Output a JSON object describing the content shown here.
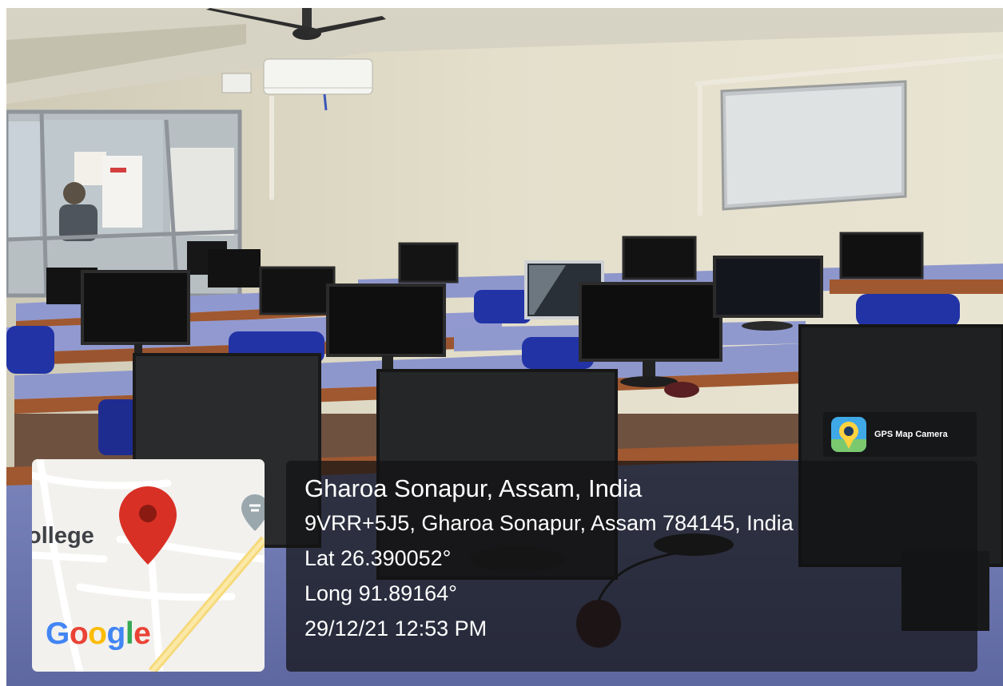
{
  "badge": {
    "label": "GPS Map Camera",
    "icon": "gps-map-camera-icon"
  },
  "location": {
    "title": "Gharoa Sonapur, Assam, India",
    "address": "9VRR+5J5, Gharoa Sonapur, Assam 784145, India",
    "latitude": "Lat 26.390052°",
    "longitude": "Long 91.89164°",
    "datetime": "29/12/21 12:53 PM"
  },
  "map": {
    "place_label": "ollege",
    "logo_letters": [
      "G",
      "o",
      "o",
      "g",
      "l",
      "e"
    ],
    "logo_colors": [
      "#4285F4",
      "#EA4335",
      "#FBBC05",
      "#4285F4",
      "#34A853",
      "#EA4335"
    ],
    "pin_color": "#d93025",
    "pin_icon": "location-pin-icon",
    "poi_icon": "poi-marker-icon"
  },
  "colors": {
    "overlay_bg": "#141416",
    "overlay_text": "#ffffff",
    "desk_top": "#8e97cc",
    "desk_edge": "#a05830",
    "chair": "#2233a6"
  }
}
